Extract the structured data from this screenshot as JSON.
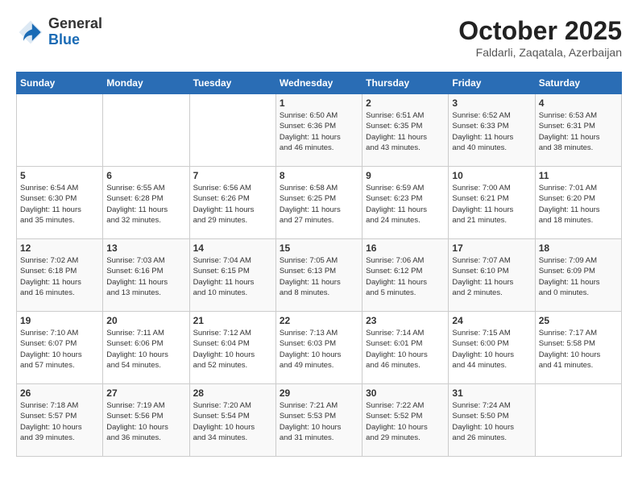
{
  "header": {
    "logo_general": "General",
    "logo_blue": "Blue",
    "month": "October 2025",
    "location": "Faldarli, Zaqatala, Azerbaijan"
  },
  "weekdays": [
    "Sunday",
    "Monday",
    "Tuesday",
    "Wednesday",
    "Thursday",
    "Friday",
    "Saturday"
  ],
  "weeks": [
    [
      {
        "day": "",
        "info": ""
      },
      {
        "day": "",
        "info": ""
      },
      {
        "day": "",
        "info": ""
      },
      {
        "day": "1",
        "info": "Sunrise: 6:50 AM\nSunset: 6:36 PM\nDaylight: 11 hours\nand 46 minutes."
      },
      {
        "day": "2",
        "info": "Sunrise: 6:51 AM\nSunset: 6:35 PM\nDaylight: 11 hours\nand 43 minutes."
      },
      {
        "day": "3",
        "info": "Sunrise: 6:52 AM\nSunset: 6:33 PM\nDaylight: 11 hours\nand 40 minutes."
      },
      {
        "day": "4",
        "info": "Sunrise: 6:53 AM\nSunset: 6:31 PM\nDaylight: 11 hours\nand 38 minutes."
      }
    ],
    [
      {
        "day": "5",
        "info": "Sunrise: 6:54 AM\nSunset: 6:30 PM\nDaylight: 11 hours\nand 35 minutes."
      },
      {
        "day": "6",
        "info": "Sunrise: 6:55 AM\nSunset: 6:28 PM\nDaylight: 11 hours\nand 32 minutes."
      },
      {
        "day": "7",
        "info": "Sunrise: 6:56 AM\nSunset: 6:26 PM\nDaylight: 11 hours\nand 29 minutes."
      },
      {
        "day": "8",
        "info": "Sunrise: 6:58 AM\nSunset: 6:25 PM\nDaylight: 11 hours\nand 27 minutes."
      },
      {
        "day": "9",
        "info": "Sunrise: 6:59 AM\nSunset: 6:23 PM\nDaylight: 11 hours\nand 24 minutes."
      },
      {
        "day": "10",
        "info": "Sunrise: 7:00 AM\nSunset: 6:21 PM\nDaylight: 11 hours\nand 21 minutes."
      },
      {
        "day": "11",
        "info": "Sunrise: 7:01 AM\nSunset: 6:20 PM\nDaylight: 11 hours\nand 18 minutes."
      }
    ],
    [
      {
        "day": "12",
        "info": "Sunrise: 7:02 AM\nSunset: 6:18 PM\nDaylight: 11 hours\nand 16 minutes."
      },
      {
        "day": "13",
        "info": "Sunrise: 7:03 AM\nSunset: 6:16 PM\nDaylight: 11 hours\nand 13 minutes."
      },
      {
        "day": "14",
        "info": "Sunrise: 7:04 AM\nSunset: 6:15 PM\nDaylight: 11 hours\nand 10 minutes."
      },
      {
        "day": "15",
        "info": "Sunrise: 7:05 AM\nSunset: 6:13 PM\nDaylight: 11 hours\nand 8 minutes."
      },
      {
        "day": "16",
        "info": "Sunrise: 7:06 AM\nSunset: 6:12 PM\nDaylight: 11 hours\nand 5 minutes."
      },
      {
        "day": "17",
        "info": "Sunrise: 7:07 AM\nSunset: 6:10 PM\nDaylight: 11 hours\nand 2 minutes."
      },
      {
        "day": "18",
        "info": "Sunrise: 7:09 AM\nSunset: 6:09 PM\nDaylight: 11 hours\nand 0 minutes."
      }
    ],
    [
      {
        "day": "19",
        "info": "Sunrise: 7:10 AM\nSunset: 6:07 PM\nDaylight: 10 hours\nand 57 minutes."
      },
      {
        "day": "20",
        "info": "Sunrise: 7:11 AM\nSunset: 6:06 PM\nDaylight: 10 hours\nand 54 minutes."
      },
      {
        "day": "21",
        "info": "Sunrise: 7:12 AM\nSunset: 6:04 PM\nDaylight: 10 hours\nand 52 minutes."
      },
      {
        "day": "22",
        "info": "Sunrise: 7:13 AM\nSunset: 6:03 PM\nDaylight: 10 hours\nand 49 minutes."
      },
      {
        "day": "23",
        "info": "Sunrise: 7:14 AM\nSunset: 6:01 PM\nDaylight: 10 hours\nand 46 minutes."
      },
      {
        "day": "24",
        "info": "Sunrise: 7:15 AM\nSunset: 6:00 PM\nDaylight: 10 hours\nand 44 minutes."
      },
      {
        "day": "25",
        "info": "Sunrise: 7:17 AM\nSunset: 5:58 PM\nDaylight: 10 hours\nand 41 minutes."
      }
    ],
    [
      {
        "day": "26",
        "info": "Sunrise: 7:18 AM\nSunset: 5:57 PM\nDaylight: 10 hours\nand 39 minutes."
      },
      {
        "day": "27",
        "info": "Sunrise: 7:19 AM\nSunset: 5:56 PM\nDaylight: 10 hours\nand 36 minutes."
      },
      {
        "day": "28",
        "info": "Sunrise: 7:20 AM\nSunset: 5:54 PM\nDaylight: 10 hours\nand 34 minutes."
      },
      {
        "day": "29",
        "info": "Sunrise: 7:21 AM\nSunset: 5:53 PM\nDaylight: 10 hours\nand 31 minutes."
      },
      {
        "day": "30",
        "info": "Sunrise: 7:22 AM\nSunset: 5:52 PM\nDaylight: 10 hours\nand 29 minutes."
      },
      {
        "day": "31",
        "info": "Sunrise: 7:24 AM\nSunset: 5:50 PM\nDaylight: 10 hours\nand 26 minutes."
      },
      {
        "day": "",
        "info": ""
      }
    ]
  ]
}
